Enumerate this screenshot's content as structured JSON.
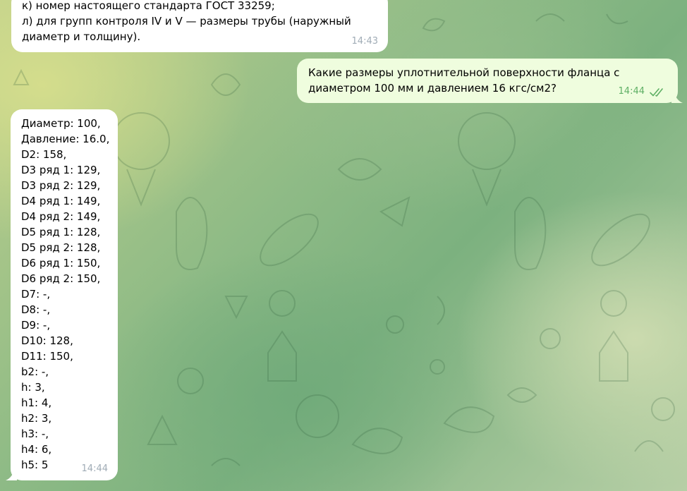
{
  "messages": [
    {
      "direction": "incoming",
      "text": "к) номер настоящего стандарта ГОСТ 33259;\nл) для групп контроля IV и V — размеры трубы (наружный\nдиаметр и толщину).",
      "time": "14:43"
    },
    {
      "direction": "outgoing",
      "text": "Какие размеры уплотнительной поверхности фланца с\nдиаметром 100 мм и давлением 16 кгс/см2?",
      "time": "14:44",
      "status": "read"
    },
    {
      "direction": "incoming",
      "text": "Диаметр: 100,\nДавление: 16.0,\nD2: 158,\nD3 ряд 1: 129,\nD3 ряд 2: 129,\nD4 ряд 1: 149,\nD4 ряд 2: 149,\nD5 ряд 1: 128,\nD5 ряд 2: 128,\nD6 ряд 1: 150,\nD6 ряд 2: 150,\nD7: -,\nD8: -,\nD9: -,\nD10: 128,\nD11: 150,\nb2: -,\nh: 3,\nh1: 4,\nh2: 3,\nh3: -,\nh4: 6,\nh5: 5",
      "time": "14:44"
    }
  ],
  "colors": {
    "incoming_bubble": "#ffffff",
    "outgoing_bubble": "#effdde",
    "outgoing_time": "#5fb065",
    "incoming_time": "#a0acb6"
  },
  "icons": {
    "read_status": "double-check-icon"
  }
}
